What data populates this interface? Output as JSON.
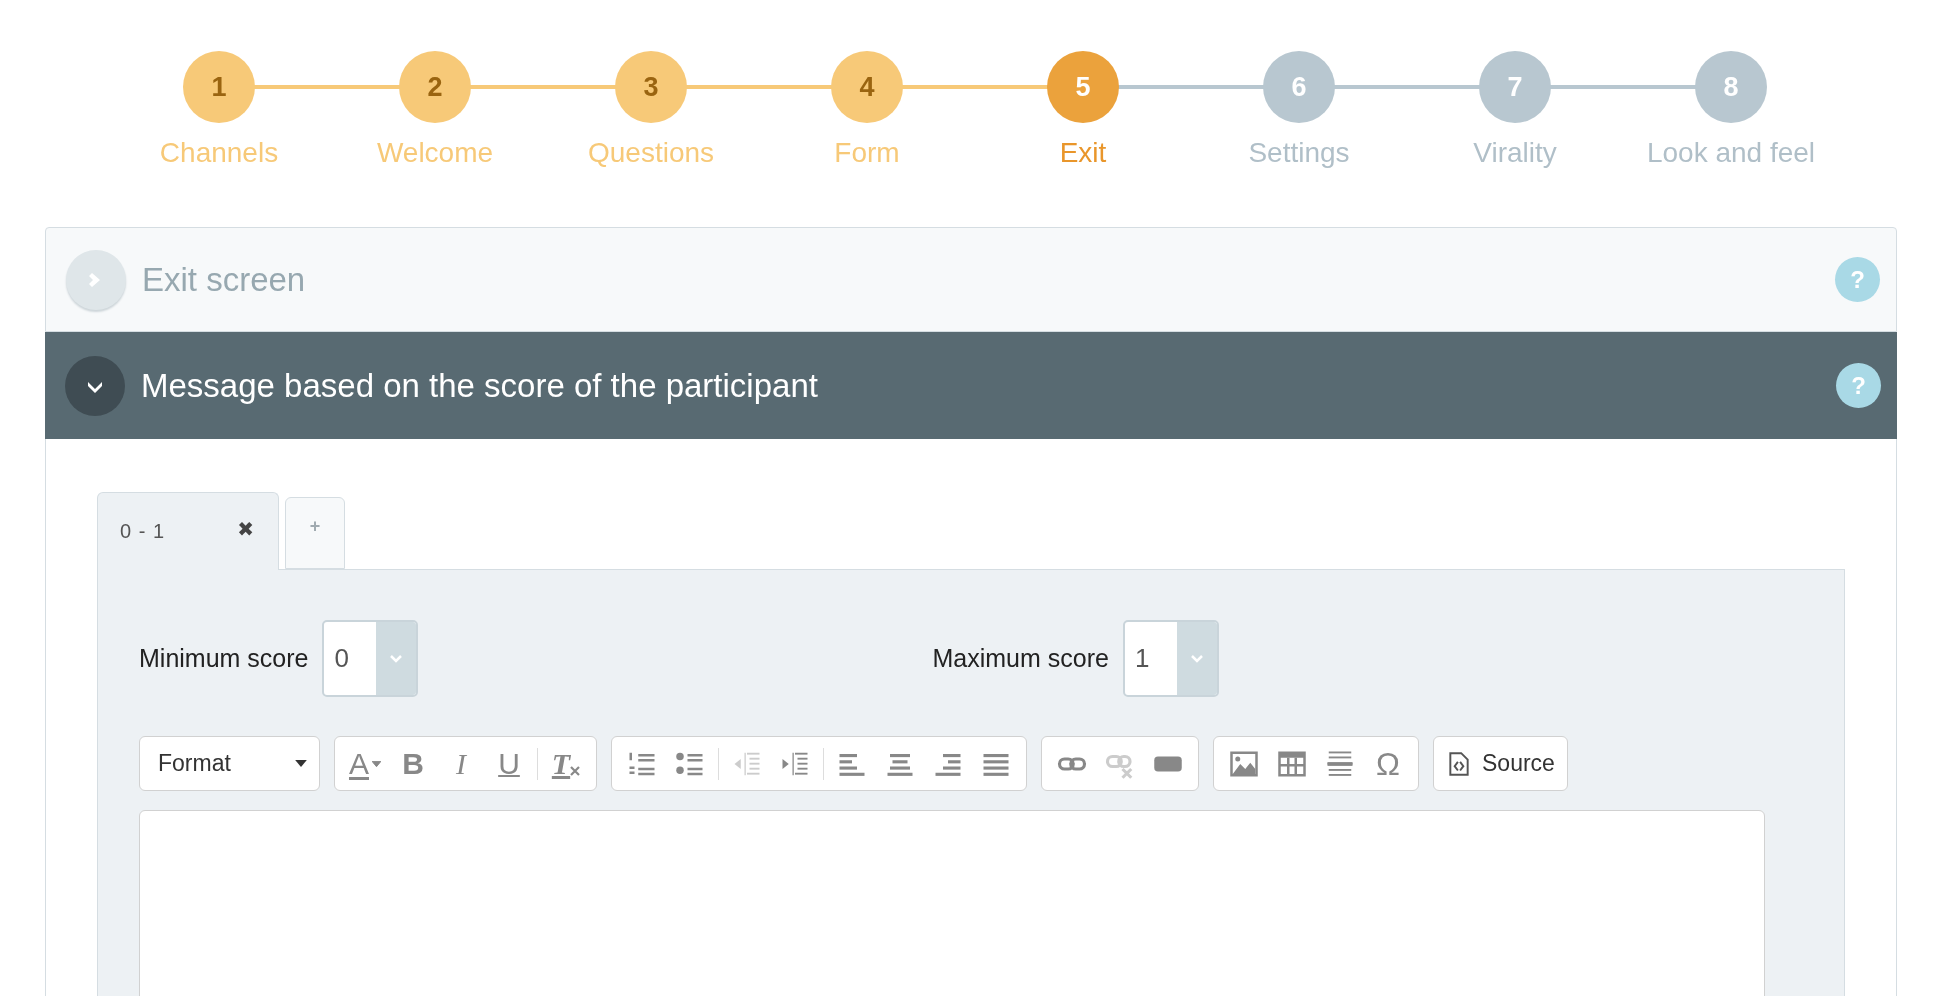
{
  "steps": [
    {
      "number": "1",
      "label": "Channels",
      "completed": true,
      "selected": false
    },
    {
      "number": "2",
      "label": "Welcome",
      "completed": true,
      "selected": false
    },
    {
      "number": "3",
      "label": "Questions",
      "completed": true,
      "selected": false
    },
    {
      "number": "4",
      "label": "Form",
      "completed": true,
      "selected": false
    },
    {
      "number": "5",
      "label": "Exit",
      "completed": false,
      "selected": true
    },
    {
      "number": "6",
      "label": "Settings",
      "completed": false,
      "selected": false
    },
    {
      "number": "7",
      "label": "Virality",
      "completed": false,
      "selected": false
    },
    {
      "number": "8",
      "label": "Look and feel",
      "completed": false,
      "selected": false
    }
  ],
  "sections": [
    {
      "title": "Exit screen",
      "expanded": false,
      "help": "?"
    },
    {
      "title": "Message based on the score of the participant",
      "expanded": true,
      "help": "?"
    }
  ],
  "score_tabs": [
    {
      "label": "0 - 1",
      "close": "✖",
      "selected": true
    }
  ],
  "add_tab": {
    "label": "+"
  },
  "min_score": {
    "label": "Minimum score",
    "value": "0"
  },
  "max_score": {
    "label": "Maximum score",
    "value": "1"
  },
  "toolbar": {
    "format": "Format",
    "groups": [
      {
        "items": [
          {
            "kind": "text-color",
            "text": "A",
            "disabled": false
          },
          {
            "kind": "bold",
            "text": "B",
            "disabled": false
          },
          {
            "kind": "italic",
            "text": "I",
            "disabled": false
          },
          {
            "kind": "underline",
            "text": "U",
            "disabled": false
          },
          {
            "kind": "separator"
          },
          {
            "kind": "remove-format",
            "text": "T",
            "disabled": false
          }
        ]
      },
      {
        "items": [
          {
            "kind": "numbered-list",
            "disabled": false
          },
          {
            "kind": "bulleted-list",
            "disabled": false
          },
          {
            "kind": "separator"
          },
          {
            "kind": "outdent",
            "disabled": true
          },
          {
            "kind": "indent",
            "disabled": false
          },
          {
            "kind": "separator"
          },
          {
            "kind": "align-left",
            "disabled": false
          },
          {
            "kind": "align-center",
            "disabled": false
          },
          {
            "kind": "align-right",
            "disabled": false
          },
          {
            "kind": "justify",
            "disabled": false
          }
        ]
      },
      {
        "items": [
          {
            "kind": "link",
            "disabled": false
          },
          {
            "kind": "unlink",
            "disabled": true
          },
          {
            "kind": "bar",
            "disabled": false
          }
        ]
      },
      {
        "items": [
          {
            "kind": "image",
            "disabled": false
          },
          {
            "kind": "table",
            "disabled": false
          },
          {
            "kind": "page-break",
            "disabled": false
          },
          {
            "kind": "special-char",
            "text": "Ω",
            "disabled": false
          }
        ]
      },
      {
        "items": [
          {
            "kind": "source",
            "text": "Source",
            "disabled": false
          }
        ]
      }
    ]
  }
}
